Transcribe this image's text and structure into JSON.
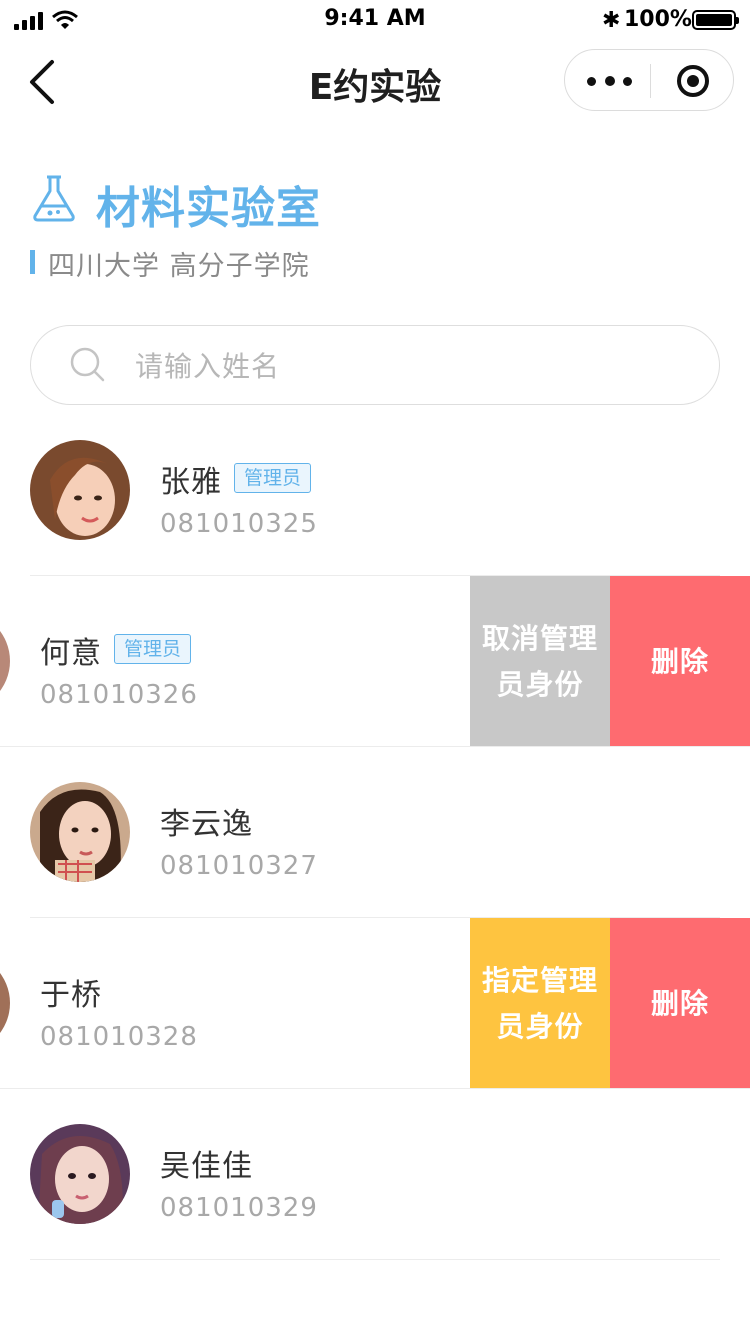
{
  "status_bar": {
    "time": "9:41 AM",
    "battery": "100%"
  },
  "nav": {
    "title": "E约实验"
  },
  "lab": {
    "name": "材料实验室",
    "subtitle": "四川大学 高分子学院"
  },
  "search": {
    "placeholder": "请输入姓名",
    "value": ""
  },
  "members": [
    {
      "name": "张雅",
      "id": "081010325",
      "badge": "管理员"
    },
    {
      "name": "何意",
      "id": "081010326",
      "badge": "管理员",
      "actions": [
        "取消管理员身份",
        "删除"
      ]
    },
    {
      "name": "李云逸",
      "id": "081010327"
    },
    {
      "name": "于桥",
      "id": "081010328",
      "actions": [
        "指定管理员身份",
        "删除"
      ]
    },
    {
      "name": "吴佳佳",
      "id": "081010329"
    }
  ],
  "actions": {
    "cancel_admin_line1": "取消管理",
    "cancel_admin_line2": "员身份",
    "assign_admin_line1": "指定管理",
    "assign_admin_line2": "员身份",
    "delete": "删除"
  },
  "colors": {
    "accent": "#62b3ea",
    "delete": "#fe6b70",
    "assign": "#fec440",
    "cancel": "#c8c8c8"
  }
}
